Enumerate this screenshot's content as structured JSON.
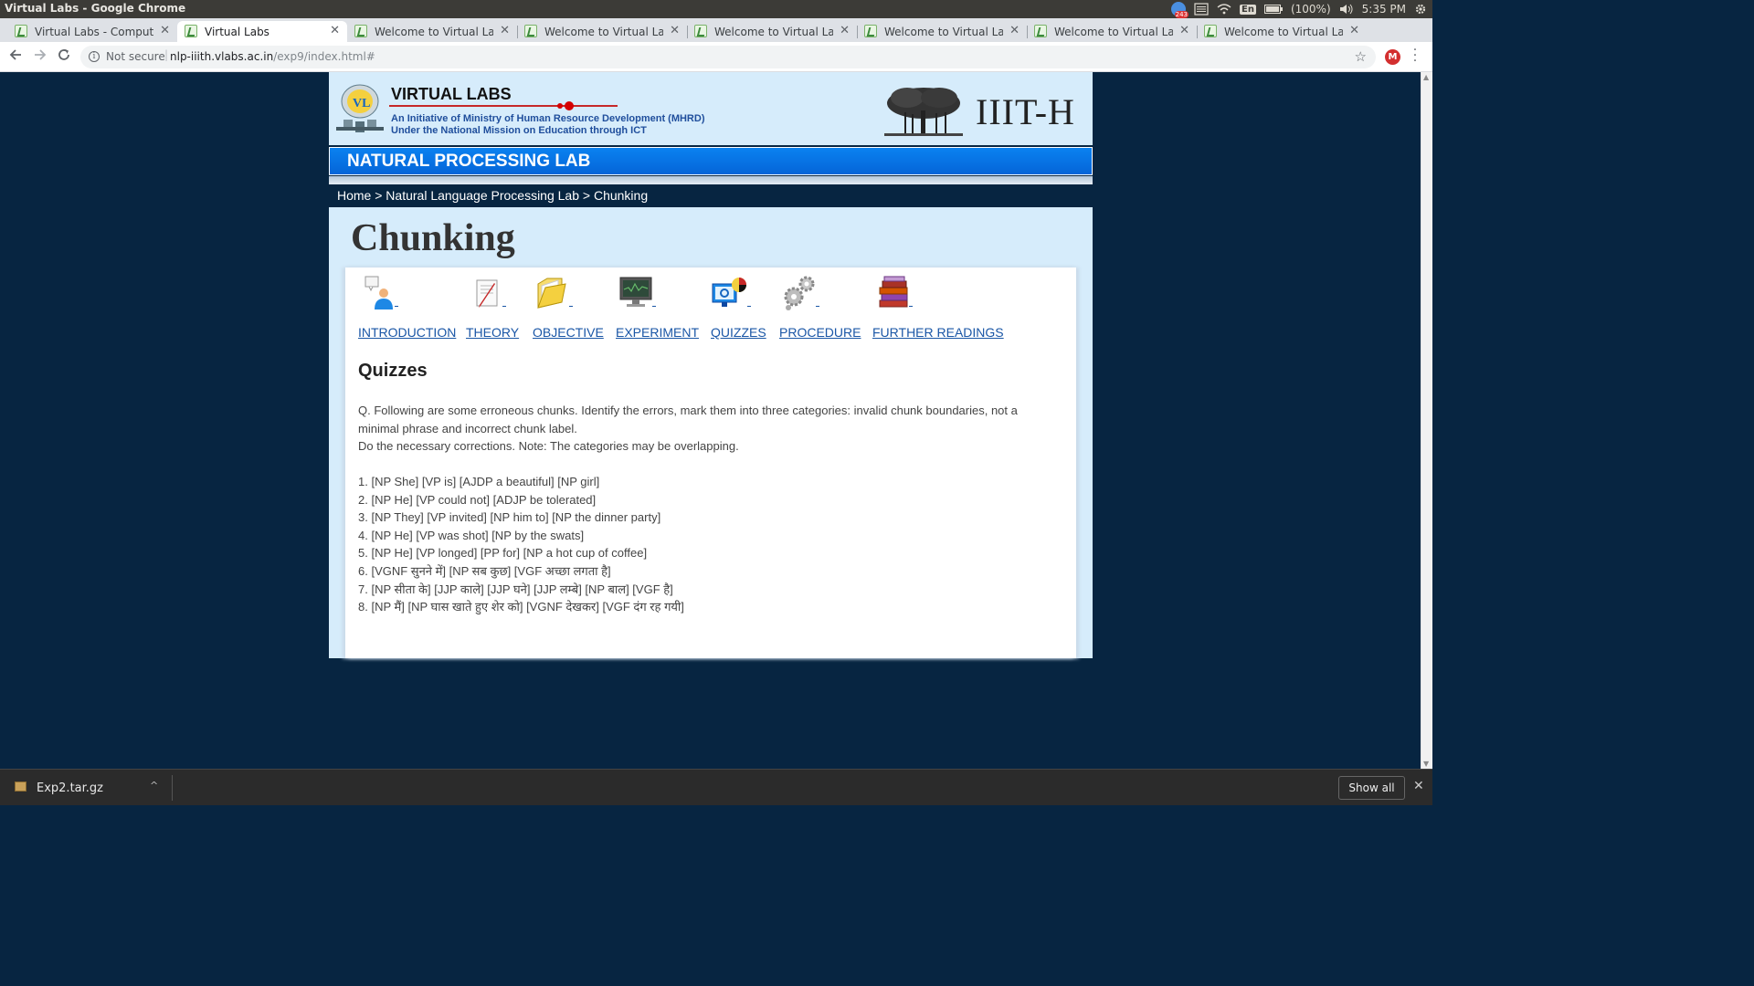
{
  "os": {
    "window_title": "Virtual Labs - Google Chrome",
    "battery": "(100%)",
    "time": "5:35 PM",
    "keyboard": "En",
    "badge_count": "243"
  },
  "browser": {
    "tabs": [
      {
        "label": "Virtual Labs - Computer",
        "active": false
      },
      {
        "label": "Virtual Labs",
        "active": true
      },
      {
        "label": "Welcome to Virtual Labs",
        "active": false
      },
      {
        "label": "Welcome to Virtual Labs",
        "active": false
      },
      {
        "label": "Welcome to Virtual Labs",
        "active": false
      },
      {
        "label": "Welcome to Virtual Labs",
        "active": false
      },
      {
        "label": "Welcome to Virtual Labs",
        "active": false
      },
      {
        "label": "Welcome to Virtual Labs",
        "active": false
      }
    ],
    "new_tab": "+",
    "security_label": "Not secure",
    "url_host": "nlp-iiith.vlabs.ac.in",
    "url_path": "/exp9/index.html#",
    "profile_initial": "M"
  },
  "site": {
    "brand_title": "VIRTUAL LABS",
    "brand_sub1": "An Initiative of Ministry of Human Resource Development (MHRD)",
    "brand_sub2": "Under the National Mission on Education through ICT",
    "institute": "IIIT-H",
    "lab_title": "NATURAL PROCESSING LAB",
    "breadcrumb": "Home > Natural Language Processing Lab > Chunking",
    "page_title": "Chunking",
    "nav": [
      {
        "label": "INTRODUCTION",
        "icon": "person-speech-icon"
      },
      {
        "label": "THEORY",
        "icon": "pencil-paper-icon"
      },
      {
        "label": "OBJECTIVE",
        "icon": "folder-icon"
      },
      {
        "label": "EXPERIMENT",
        "icon": "monitor-icon"
      },
      {
        "label": "QUIZZES",
        "icon": "quiz-computer-icon"
      },
      {
        "label": "PROCEDURE",
        "icon": "gears-icon"
      },
      {
        "label": "FURTHER READINGS",
        "icon": "books-icon"
      }
    ],
    "section_heading": "Quizzes",
    "question_line1": "Q. Following are some erroneous chunks. Identify the errors, mark them into three categories: invalid chunk boundaries, not a minimal phrase and incorrect chunk label.",
    "question_line2": "Do the necessary corrections. Note: The categories may be overlapping.",
    "items": [
      "1. [NP She] [VP is] [AJDP a beautiful] [NP girl]",
      "2. [NP He] [VP could not] [ADJP be tolerated]",
      "3. [NP They] [VP invited] [NP him to] [NP the dinner party]",
      "4. [NP He] [VP was shot] [NP by the swats]",
      "5. [NP He] [VP longed] [PP for] [NP a hot cup of coffee]",
      "6. [VGNF सुनने में] [NP सब कुछ] [VGF अच्छा लगता है]",
      "7. [NP सीता के] [JJP काले] [JJP घने] [JJP लम्बे] [NP बाल] [VGF है]",
      "8. [NP मैं] [NP घास खाते हुए शेर को] [VGNF देखकर] [VGF दंग रह गयी]"
    ]
  },
  "downloads": {
    "file_name": "Exp2.tar.gz",
    "show_all": "Show all"
  },
  "colors": {
    "page_bg": "#072541",
    "banner_bg": "#d6ecfb",
    "lab_bar": "#0a82f0",
    "link": "#1a56a6"
  }
}
